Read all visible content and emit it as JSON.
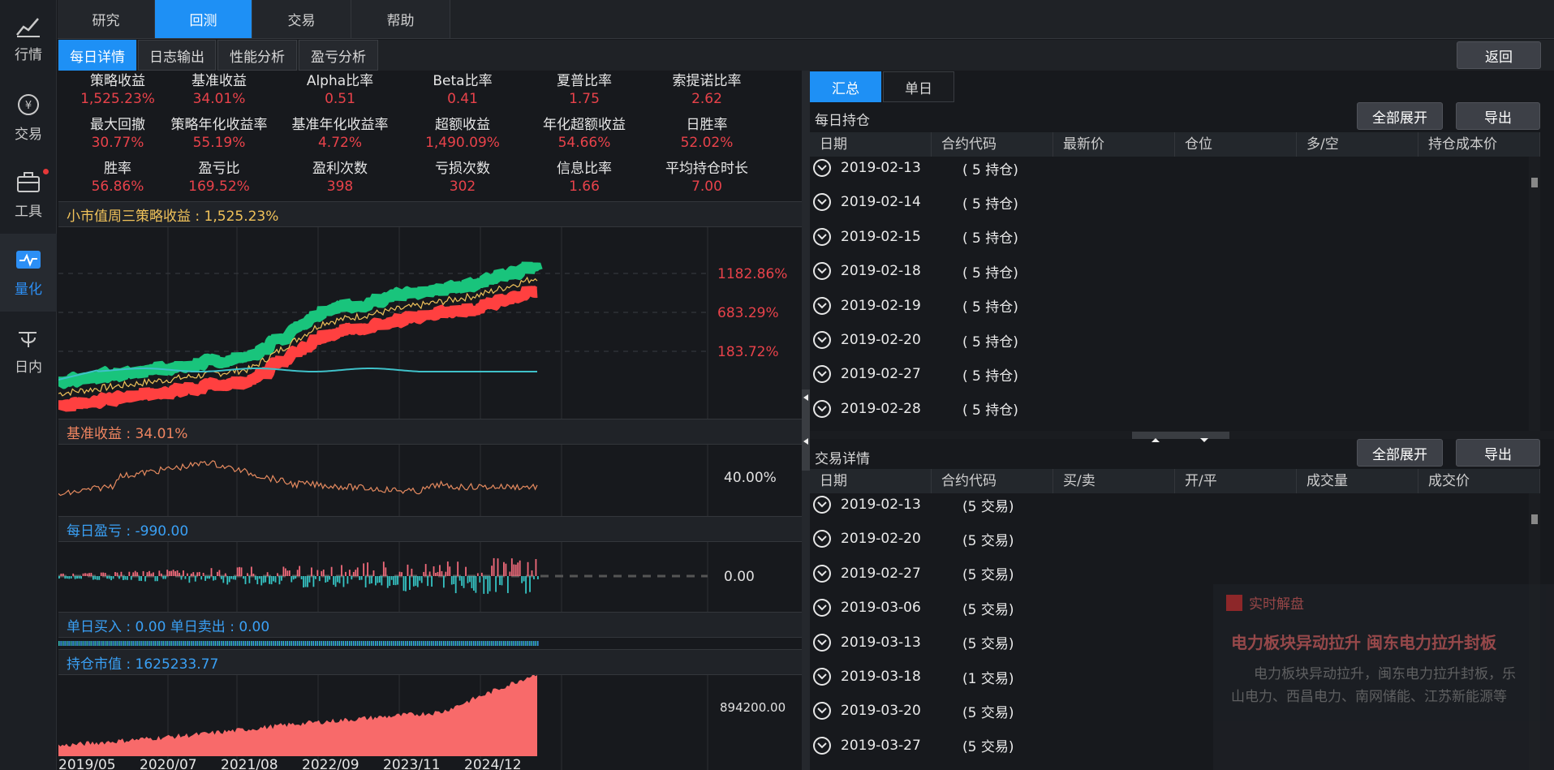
{
  "rail": {
    "items": [
      {
        "label": "行情"
      },
      {
        "label": "交易"
      },
      {
        "label": "工具"
      },
      {
        "label": "量化"
      },
      {
        "label": "日内"
      }
    ]
  },
  "top_tabs": [
    "研究",
    "回测",
    "交易",
    "帮助"
  ],
  "sub_tabs": [
    "每日详情",
    "日志输出",
    "性能分析",
    "盈亏分析"
  ],
  "back_label": "返回",
  "metrics": [
    {
      "label": "策略收益",
      "value": "1,525.23%"
    },
    {
      "label": "基准收益",
      "value": "34.01%"
    },
    {
      "label": "Alpha比率",
      "value": "0.51"
    },
    {
      "label": "Beta比率",
      "value": "0.41"
    },
    {
      "label": "夏普比率",
      "value": "1.75"
    },
    {
      "label": "索提诺比率",
      "value": "2.62"
    },
    {
      "label": "最大回撤",
      "value": "30.77%"
    },
    {
      "label": "策略年化收益率",
      "value": "55.19%"
    },
    {
      "label": "基准年化收益率",
      "value": "4.72%"
    },
    {
      "label": "超额收益",
      "value": "1,490.09%"
    },
    {
      "label": "年化超额收益",
      "value": "54.66%"
    },
    {
      "label": "日胜率",
      "value": "52.02%"
    },
    {
      "label": "胜率",
      "value": "56.86%"
    },
    {
      "label": "盈亏比",
      "value": "169.52%"
    },
    {
      "label": "盈利次数",
      "value": "398"
    },
    {
      "label": "亏损次数",
      "value": "302"
    },
    {
      "label": "信息比率",
      "value": "1.66"
    },
    {
      "label": "平均持仓时长",
      "value": "7.00"
    }
  ],
  "panels": {
    "strategy": "小市值周三策略收益 : 1,525.23%",
    "benchmark": "基准收益 : 34.01%",
    "daily_pnl": "每日盈亏 : -990.00",
    "buy_sell": "单日买入 : 0.00  单日卖出 : 0.00",
    "position": "持仓市值 : 1625233.77"
  },
  "chart_data": [
    {
      "type": "line",
      "title": "小市值周三策略收益 : 1,525.23%",
      "y_ticks": [
        "1182.86%",
        "683.29%",
        "183.72%"
      ]
    },
    {
      "type": "line",
      "title": "基准收益 : 34.01%",
      "y_ticks": [
        "40.00%"
      ]
    },
    {
      "type": "bar",
      "title": "每日盈亏 : -990.00",
      "y_ticks": [
        "0.00"
      ]
    },
    {
      "type": "area",
      "title": "持仓市值 : 1625233.77",
      "y_ticks": [
        "894200.00"
      ],
      "x_ticks": [
        "2019/05",
        "2020/07",
        "2021/08",
        "2022/09",
        "2023/11",
        "2024/12"
      ]
    }
  ],
  "right": {
    "tabs": [
      "汇总",
      "单日"
    ],
    "holdings": {
      "title": "每日持仓",
      "expand": "全部展开",
      "export": "导出",
      "columns": [
        "日期",
        "合约代码",
        "最新价",
        "仓位",
        "多/空",
        "持仓成本价"
      ],
      "rows": [
        {
          "date": "2019-02-13",
          "info": "( 5 持仓)"
        },
        {
          "date": "2019-02-14",
          "info": "( 5 持仓)"
        },
        {
          "date": "2019-02-15",
          "info": "( 5 持仓)"
        },
        {
          "date": "2019-02-18",
          "info": "( 5 持仓)"
        },
        {
          "date": "2019-02-19",
          "info": "( 5 持仓)"
        },
        {
          "date": "2019-02-20",
          "info": "( 5 持仓)"
        },
        {
          "date": "2019-02-27",
          "info": "( 5 持仓)"
        },
        {
          "date": "2019-02-28",
          "info": "( 5 持仓)"
        }
      ]
    },
    "trades": {
      "title": "交易详情",
      "expand": "全部展开",
      "export": "导出",
      "columns": [
        "日期",
        "合约代码",
        "买/卖",
        "开/平",
        "成交量",
        "成交价"
      ],
      "rows": [
        {
          "date": "2019-02-13",
          "info": "(5 交易)"
        },
        {
          "date": "2019-02-20",
          "info": "(5 交易)"
        },
        {
          "date": "2019-02-27",
          "info": "(5 交易)"
        },
        {
          "date": "2019-03-06",
          "info": "(5 交易)"
        },
        {
          "date": "2019-03-13",
          "info": "(5 交易)"
        },
        {
          "date": "2019-03-18",
          "info": "(1 交易)"
        },
        {
          "date": "2019-03-20",
          "info": "(5 交易)"
        },
        {
          "date": "2019-03-27",
          "info": "(5 交易)"
        }
      ]
    }
  },
  "popup": {
    "tag": "实时解盘",
    "headline": "电力板块异动拉升 闽东电力拉升封板",
    "body1": "电力板块异动拉升，闽东电力拉升封板，乐",
    "body2": "山电力、西昌电力、南网储能、江苏新能源等"
  }
}
